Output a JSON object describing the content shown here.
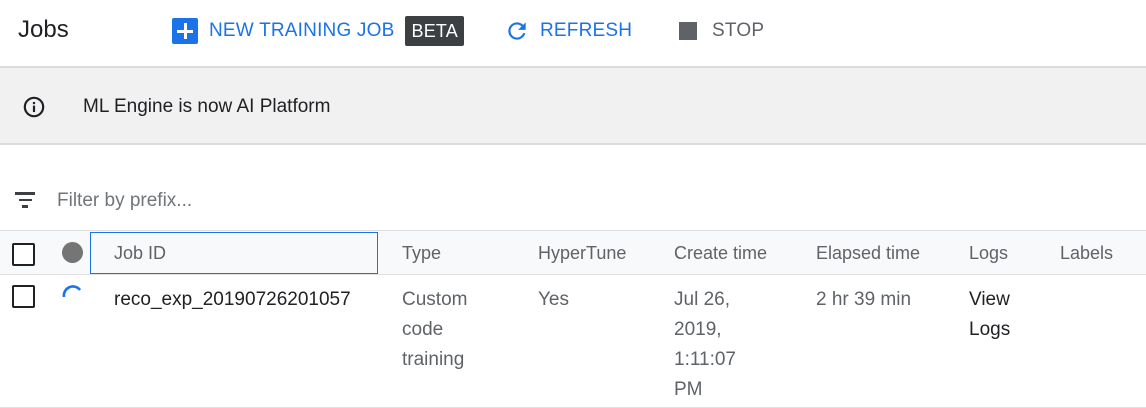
{
  "header": {
    "title": "Jobs",
    "new_training_job_label": "NEW TRAINING JOB",
    "beta_badge": "BETA",
    "refresh_label": "REFRESH",
    "stop_label": "STOP"
  },
  "banner": {
    "message": "ML Engine is now AI Platform"
  },
  "filter": {
    "placeholder": "Filter by prefix..."
  },
  "table": {
    "columns": [
      "Job ID",
      "Type",
      "HyperTune",
      "Create time",
      "Elapsed time",
      "Logs",
      "Labels"
    ],
    "rows": [
      {
        "job_id": "reco_exp_20190726201057",
        "type_lines": [
          "Custom",
          "code",
          "training"
        ],
        "hypertune": "Yes",
        "create_time_lines": [
          "Jul 26,",
          "2019,",
          "1:11:07",
          "PM"
        ],
        "elapsed_time": "2 hr 39 min",
        "logs_lines": [
          "View",
          "Logs"
        ],
        "labels": ""
      }
    ]
  },
  "colors": {
    "accent": "#1a73e8",
    "badge_bg": "#3c4043",
    "banner_bg": "#f1f1f1",
    "muted_text": "#5f6368"
  },
  "icons": {
    "new_job": "plus-box-icon",
    "refresh": "refresh-icon",
    "stop": "stop-icon",
    "info": "info-icon",
    "filter": "filter-list-icon",
    "status_header": "status-dot-icon",
    "row_status": "running-spinner-icon"
  }
}
